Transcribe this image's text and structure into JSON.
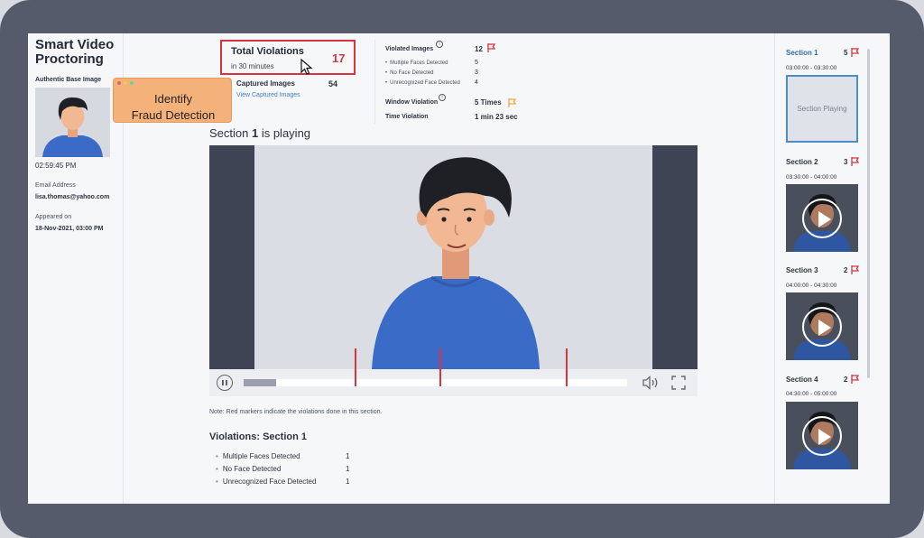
{
  "app": {
    "title": "Smart Video Proctoring"
  },
  "candidate": {
    "base_image_label": "Authentic Base Image",
    "time": "02:59:45 PM",
    "email_label": "Email Address",
    "email": "lisa.thomas@yahoo.com",
    "appeared_label": "Appeared on",
    "appeared": "18-Nov-2021, 03:00 PM"
  },
  "callout": {
    "line1": "Identify",
    "line2": "Fraud Detection"
  },
  "total_violations": {
    "title": "Total Violations",
    "subtitle": "in 30 minutes",
    "count": "17"
  },
  "captured": {
    "label": "Captured Images",
    "count": "54",
    "link": "View Captured Images"
  },
  "violated_images": {
    "label": "Violated Images",
    "count": "12",
    "items": [
      {
        "label": "Multiple Faces Detected",
        "value": "5"
      },
      {
        "label": "No Face Detected",
        "value": "3"
      },
      {
        "label": "Unrecognized Face Detected",
        "value": "4"
      }
    ]
  },
  "window_violation": {
    "label": "Window Violation",
    "value": "5 Times"
  },
  "time_violation": {
    "label": "Time Violation",
    "value": "1 min 23 sec"
  },
  "player": {
    "heading_pre": "Section ",
    "heading_num": "1",
    "heading_post": " is playing",
    "progress": 0.085,
    "markers": [
      0.29,
      0.51,
      0.84
    ],
    "note": "Note: Red markers indicate the violations done in this section."
  },
  "violations_section": {
    "title": "Violations: Section 1",
    "items": [
      {
        "label": "Multiple Faces Detected",
        "value": "1"
      },
      {
        "label": "No Face Detected",
        "value": "1"
      },
      {
        "label": "Unrecognized Face Detected",
        "value": "1"
      }
    ]
  },
  "sections": [
    {
      "title": "Section 1",
      "count": "5",
      "range": "03:00:00 - 03:30:00",
      "playing": "Section Playing",
      "active": true
    },
    {
      "title": "Section 2",
      "count": "3",
      "range": "03:30:00 - 04:00:00",
      "active": false
    },
    {
      "title": "Section 3",
      "count": "2",
      "range": "04:00:00 - 04:30:00",
      "active": false
    },
    {
      "title": "Section 4",
      "count": "2",
      "range": "04:30:00 - 05:00:00",
      "active": false
    }
  ],
  "colors": {
    "accent_red": "#d93340",
    "flag_orange": "#f0a640",
    "link_blue": "#3f7fd0",
    "shirt_blue": "#3a6bc7"
  },
  "icons": [
    "cursor-icon",
    "info-icon",
    "flag-icon",
    "pause-icon",
    "volume-icon",
    "fullscreen-icon",
    "play-icon"
  ]
}
